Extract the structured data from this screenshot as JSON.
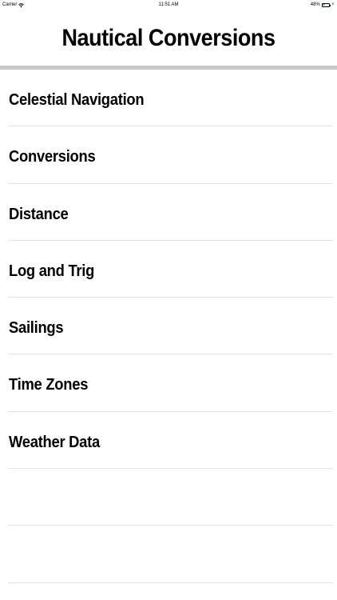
{
  "status_bar": {
    "carrier": "Carrier",
    "time": "11:51 AM",
    "battery_percent": "48%",
    "battery_level": 0.48,
    "battery_color": "#4cd964"
  },
  "header": {
    "title": "Nautical Conversions"
  },
  "menu": {
    "items": [
      {
        "label": "Celestial Navigation"
      },
      {
        "label": "Conversions"
      },
      {
        "label": "Distance"
      },
      {
        "label": "Log and Trig"
      },
      {
        "label": "Sailings"
      },
      {
        "label": "Time Zones"
      },
      {
        "label": "Weather Data"
      },
      {
        "label": ""
      },
      {
        "label": ""
      }
    ]
  }
}
